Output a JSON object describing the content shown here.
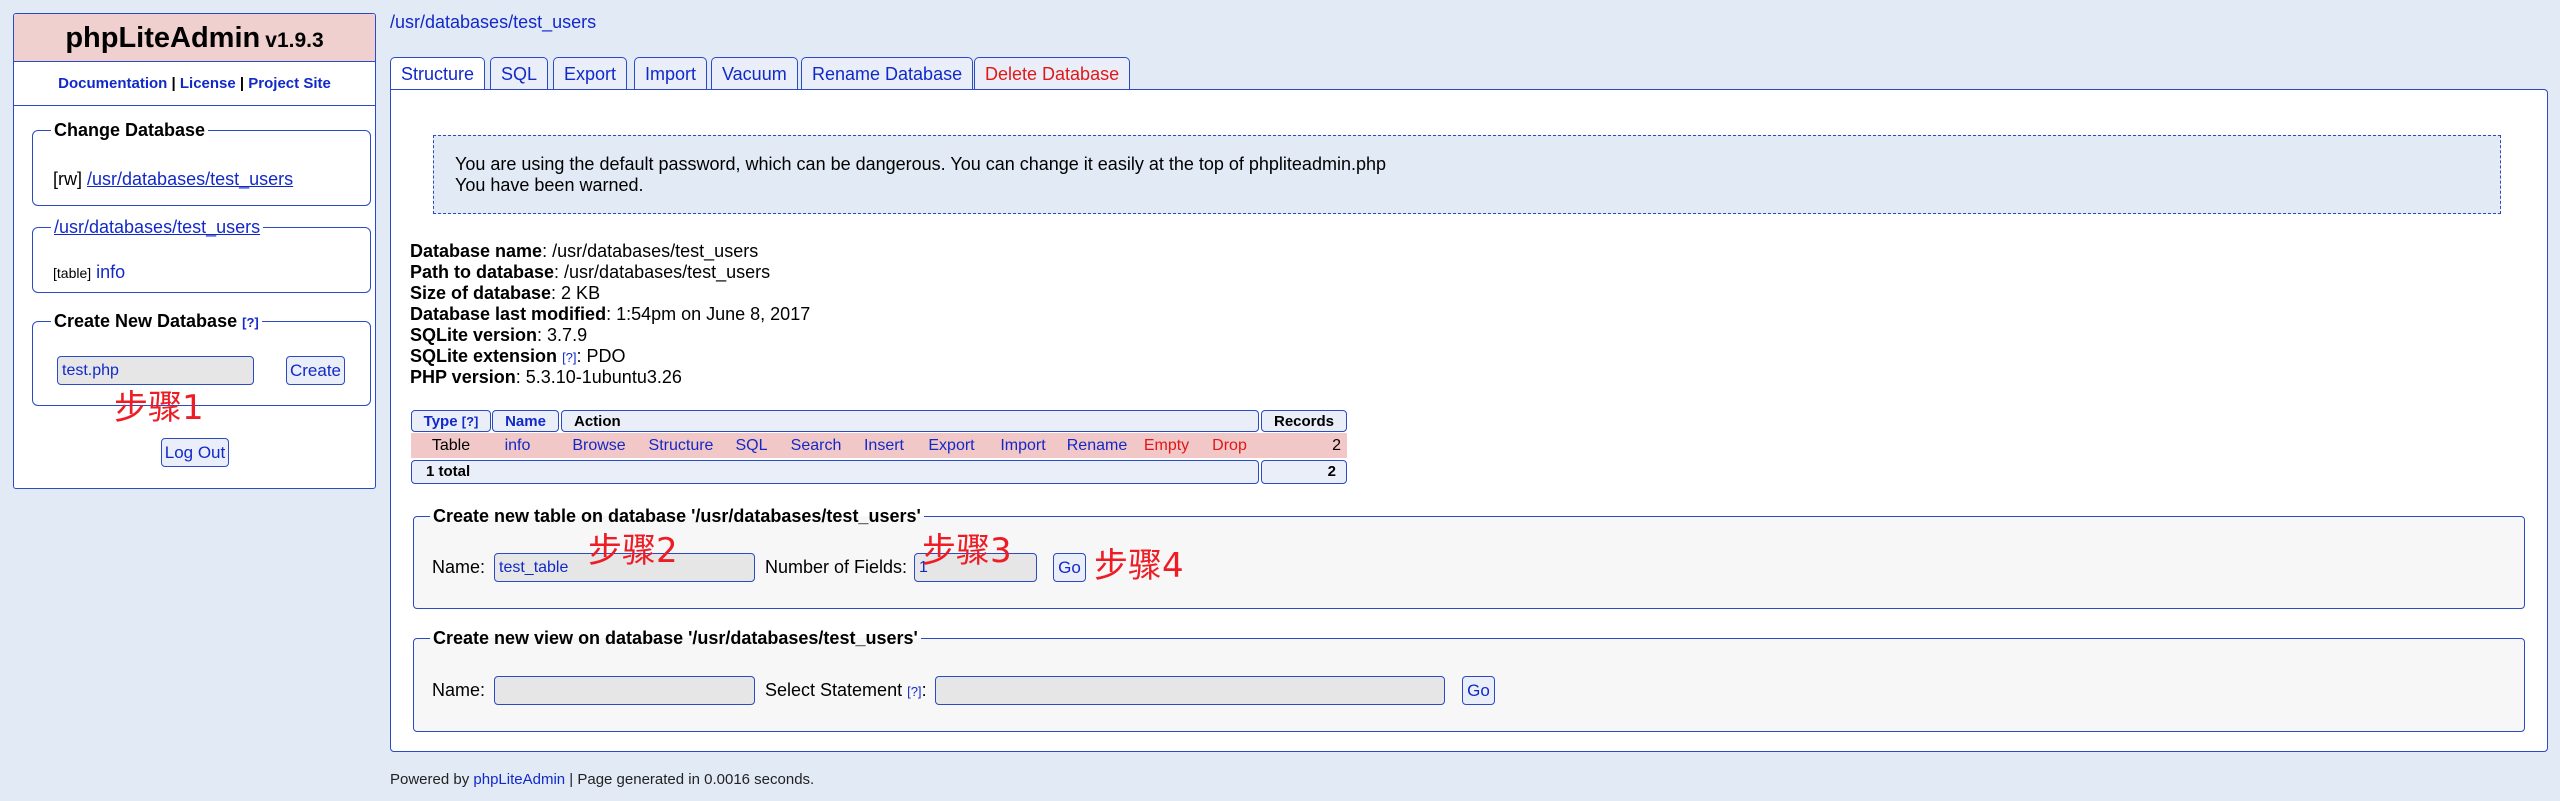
{
  "sidebar": {
    "app_name": "phpLiteAdmin",
    "version": "v1.9.3",
    "links": [
      "Documentation",
      "License",
      "Project Site"
    ],
    "change_db": {
      "legend": "Change Database",
      "mode": "[rw]",
      "db_link": "/usr/databases/test_users"
    },
    "db_box": {
      "legend": "/usr/databases/test_users",
      "item_type": "[table]",
      "item_name": "info"
    },
    "create_db": {
      "legend": "Create New Database",
      "help": "[?]",
      "input_value": "test.php",
      "button": "Create"
    },
    "logout": "Log Out"
  },
  "annotations": {
    "step1": "步骤1",
    "step2": "步骤2",
    "step3": "步骤3",
    "step4": "步骤4"
  },
  "main": {
    "path": "/usr/databases/test_users",
    "tabs": [
      "Structure",
      "SQL",
      "Export",
      "Import",
      "Vacuum",
      "Rename Database",
      "Delete Database"
    ],
    "active_tab": "Structure",
    "warning_line1": "You are using the default password, which can be dangerous. You can change it easily at the top of phpliteadmin.php",
    "warning_line2": "You have been warned.",
    "info": {
      "db_name_label": "Database name",
      "db_name": ": /usr/databases/test_users",
      "path_label": "Path to database",
      "path": ": /usr/databases/test_users",
      "size_label": "Size of database",
      "size": ": 2 KB",
      "modified_label": "Database last modified",
      "modified": ": 1:54pm on June 8, 2017",
      "sqlite_label": "SQLite version",
      "sqlite": ": 3.7.9",
      "ext_label": "SQLite extension",
      "ext_help": "[?]",
      "ext": ": PDO",
      "php_label": "PHP version",
      "php": ": 5.3.10-1ubuntu3.26"
    },
    "table": {
      "headers": {
        "type": "Type",
        "type_help": "[?]",
        "name": "Name",
        "action": "Action",
        "records": "Records"
      },
      "row": {
        "type": "Table",
        "name": "info",
        "actions": [
          "Browse",
          "Structure",
          "SQL",
          "Search",
          "Insert",
          "Export",
          "Import",
          "Rename",
          "Empty",
          "Drop"
        ],
        "records": "2"
      },
      "total_label": "1 total",
      "total_records": "2"
    },
    "create_table": {
      "legend": "Create new table on database '/usr/databases/test_users'",
      "name_label": "Name:",
      "name_value": "test_table",
      "fields_label": "Number of Fields:",
      "fields_value": "1",
      "go": "Go"
    },
    "create_view": {
      "legend": "Create new view on database '/usr/databases/test_users'",
      "name_label": "Name:",
      "select_label": "Select Statement",
      "select_help": "[?]",
      "colon": ":",
      "go": "Go"
    }
  },
  "footer": {
    "powered": "Powered by",
    "link": "phpLiteAdmin",
    "rest": "| Page generated in 0.0016 seconds."
  }
}
